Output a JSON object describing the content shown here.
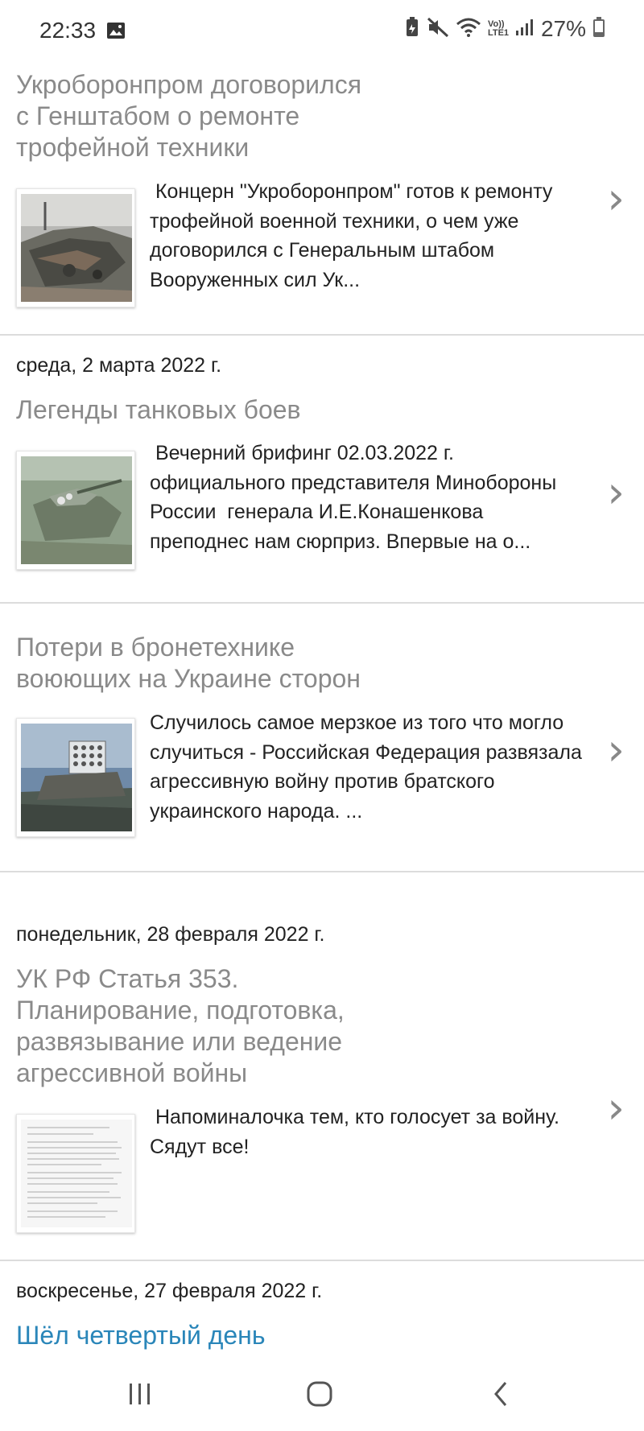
{
  "status": {
    "time": "22:33",
    "battery": "27%",
    "volte": "Vo)) LTE1",
    "icons": [
      "image-icon",
      "battery-saver-icon",
      "mute-icon",
      "wifi-icon",
      "signal-icon",
      "battery-icon"
    ]
  },
  "feed": {
    "posts": [
      {
        "title_lines": [
          "Укроборонпром договорился",
          "с Генштабом о ремонте",
          "трофейной техники"
        ],
        "snippet": " Концерн \"Укроборонпром\" готов к ремонту трофейной военной техники, о чем уже договорился с Генеральным штабом Вооруженных сил Ук...",
        "thumb": "destroyed-tank-photo"
      },
      {
        "date": "среда, 2 марта 2022 г.",
        "title_lines": [
          "Легенды танковых боев"
        ],
        "snippet": " Вечерний брифинг 02.03.2022 г. официального представителя Минобороны России  генерала И.Е.Конашенкова  преподнес нам сюрприз. Впервые на о...",
        "thumb": "tank-field-photo"
      },
      {
        "title_lines": [
          "Потери в бронетехнике",
          "воюющих на Украине сторон"
        ],
        "snippet": "Случилось самое мерзкое из того что могло случиться - Российская Федерация развязала агрессивную войну против братского украинского народа. ...",
        "thumb": "rocket-launcher-photo"
      },
      {
        "date": "понедельник, 28 февраля 2022 г.",
        "title_lines": [
          "УК РФ Статья 353.",
          "Планирование, подготовка,",
          "развязывание или ведение",
          "агрессивной войны"
        ],
        "snippet": " Напоминалочка тем, кто голосует за войну. Сядут все!",
        "thumb": "document-page-photo"
      },
      {
        "date": "воскресенье, 27 февраля 2022 г.",
        "title_lines": [
          "Шёл четвертый день"
        ]
      }
    ],
    "chevron": "›"
  },
  "navbar": {
    "buttons": [
      "recent-apps-icon",
      "home-icon",
      "back-icon"
    ]
  },
  "colors": {
    "title_gray": "#8a8a8a",
    "link_blue": "#2a86b9",
    "separator": "#dcdcdc"
  }
}
